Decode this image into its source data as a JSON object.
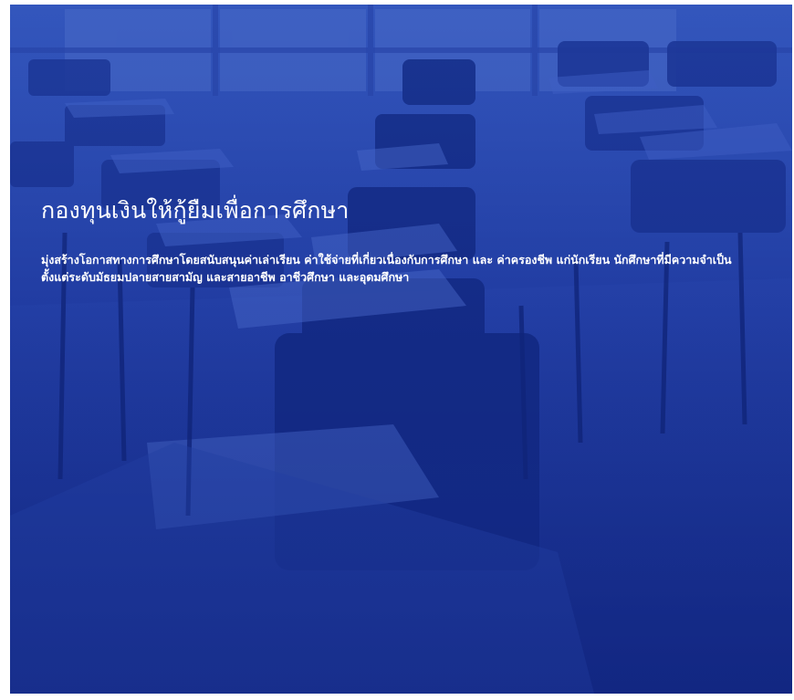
{
  "hero": {
    "title": "กองทุนเงินให้กู้ยืมเพื่อการศึกษา",
    "description": "มุ่งสร้างโอกาสทางการศึกษาโดยสนับสนุนค่าเล่าเรียน ค่าใช้จ่ายที่เกี่ยวเนื่องกับการศึกษา และ ค่าครองชีพ แก่นักเรียน นักศึกษาที่มีความจำเป็น ตั้งแต่ระดับมัธยมปลายสายสามัญ และสายอาชีพ อาชีวศึกษา และอุดมศึกษา",
    "background_image": "classroom-desks-photo"
  },
  "colors": {
    "overlay_blue": "#1a3191",
    "text": "#ffffff"
  }
}
